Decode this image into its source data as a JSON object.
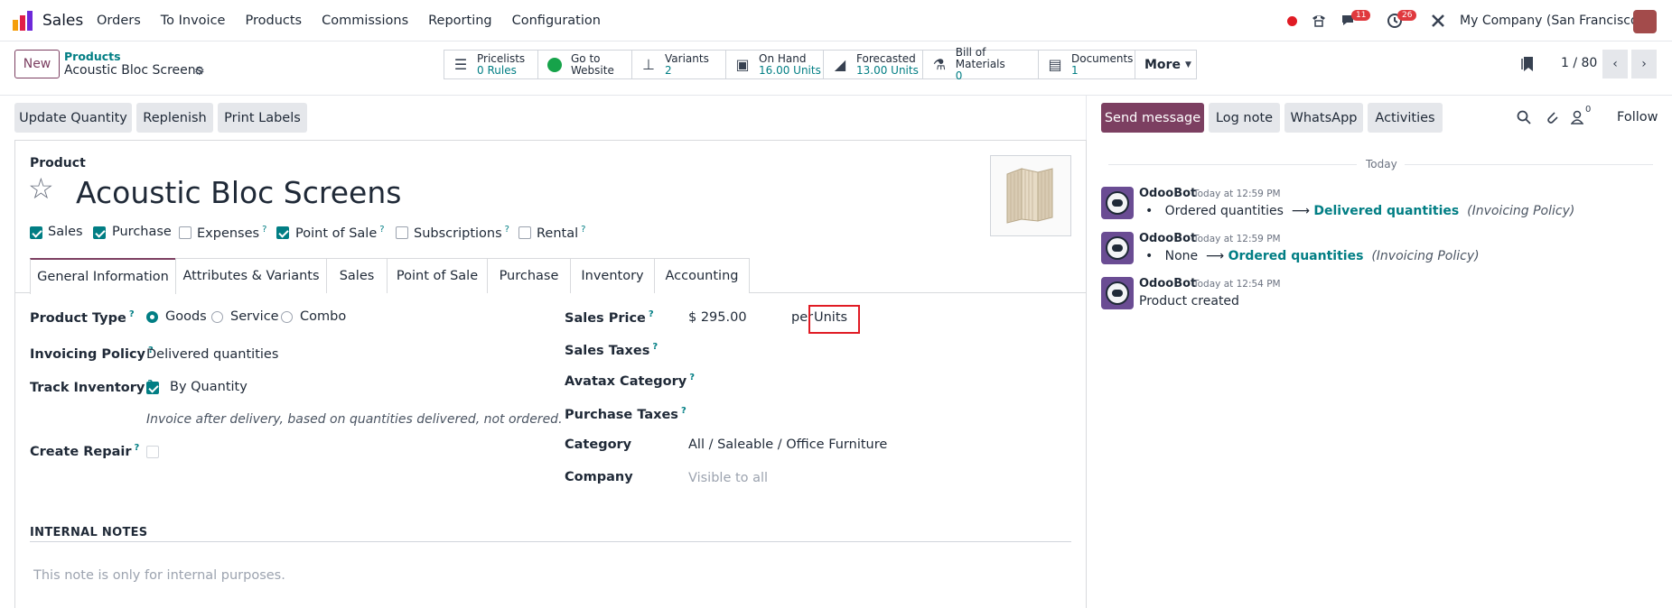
{
  "topnav": {
    "app": "Sales",
    "menu": [
      "Orders",
      "To Invoice",
      "Products",
      "Commissions",
      "Reporting",
      "Configuration"
    ],
    "messages_count": "11",
    "activities_count": "26",
    "company": "My Company (San Francisco)"
  },
  "breadcrumb": {
    "parent": "Products",
    "current": "Acoustic Bloc Screens"
  },
  "buttons": {
    "new": "New"
  },
  "smart_buttons": [
    {
      "icon": "list-icon",
      "line1": "Pricelists",
      "line2": "0 Rules"
    },
    {
      "icon": "globe-icon",
      "line1": "Go to",
      "line2": "Website"
    },
    {
      "icon": "sitemap-icon",
      "line1": "Variants",
      "line2": "2"
    },
    {
      "icon": "cubes-icon",
      "line1": "On Hand",
      "line2": "16.00 Units"
    },
    {
      "icon": "area-chart-icon",
      "line1": "Forecasted",
      "line2": "13.00 Units"
    },
    {
      "icon": "flask-icon",
      "line1": "Bill of Materials",
      "line2": "0"
    },
    {
      "icon": "document-icon",
      "line1": "Documents",
      "line2": "1"
    }
  ],
  "more_label": "More",
  "pager": {
    "value": "1 / 80"
  },
  "actions": [
    "Update Quantity",
    "Replenish",
    "Print Labels"
  ],
  "chatter": {
    "send_message": "Send message",
    "log_note": "Log note",
    "whatsapp": "WhatsApp",
    "activities": "Activities",
    "followers_count": "0",
    "follow": "Follow",
    "today": "Today",
    "messages": [
      {
        "author": "OdooBot",
        "time": "Today at 12:59 PM",
        "old": "Ordered quantities",
        "arrow": "⟶",
        "new": "Delivered quantities",
        "field": "(Invoicing Policy)"
      },
      {
        "author": "OdooBot",
        "time": "Today at 12:59 PM",
        "old": "None",
        "arrow": "⟶",
        "new": "Ordered quantities",
        "field": "(Invoicing Policy)"
      },
      {
        "author": "OdooBot",
        "time": "Today at 12:54 PM",
        "body": "Product created"
      }
    ]
  },
  "form": {
    "label": "Product",
    "name": "Acoustic Bloc Screens",
    "flags": [
      {
        "label": "Sales",
        "checked": true,
        "help": false
      },
      {
        "label": "Purchase",
        "checked": true,
        "help": false
      },
      {
        "label": "Expenses",
        "checked": false,
        "help": true
      },
      {
        "label": "Point of Sale",
        "checked": true,
        "help": true
      },
      {
        "label": "Subscriptions",
        "checked": false,
        "help": true
      },
      {
        "label": "Rental",
        "checked": false,
        "help": true
      }
    ],
    "tabs": [
      "General Information",
      "Attributes & Variants",
      "Sales",
      "Point of Sale",
      "Purchase",
      "Inventory",
      "Accounting"
    ],
    "product_type_label": "Product Type",
    "product_type_options": [
      "Goods",
      "Service",
      "Combo"
    ],
    "invoicing_policy_label": "Invoicing Policy",
    "invoicing_policy_value": "Delivered quantities",
    "track_inventory_label": "Track Inventory",
    "track_inventory_value": "By Quantity",
    "invoice_hint": "Invoice after delivery, based on quantities delivered, not ordered.",
    "create_repair_label": "Create Repair",
    "sales_price_label": "Sales Price",
    "sales_price_value": "$ 295.00",
    "per_label": "per",
    "uom_value": "Units",
    "sales_taxes_label": "Sales Taxes",
    "avatax_label": "Avatax Category",
    "purchase_taxes_label": "Purchase Taxes",
    "category_label": "Category",
    "category_value": "All / Saleable / Office Furniture",
    "company_label": "Company",
    "company_placeholder": "Visible to all",
    "internal_notes_label": "INTERNAL NOTES",
    "internal_notes_placeholder": "This note is only for internal purposes."
  }
}
